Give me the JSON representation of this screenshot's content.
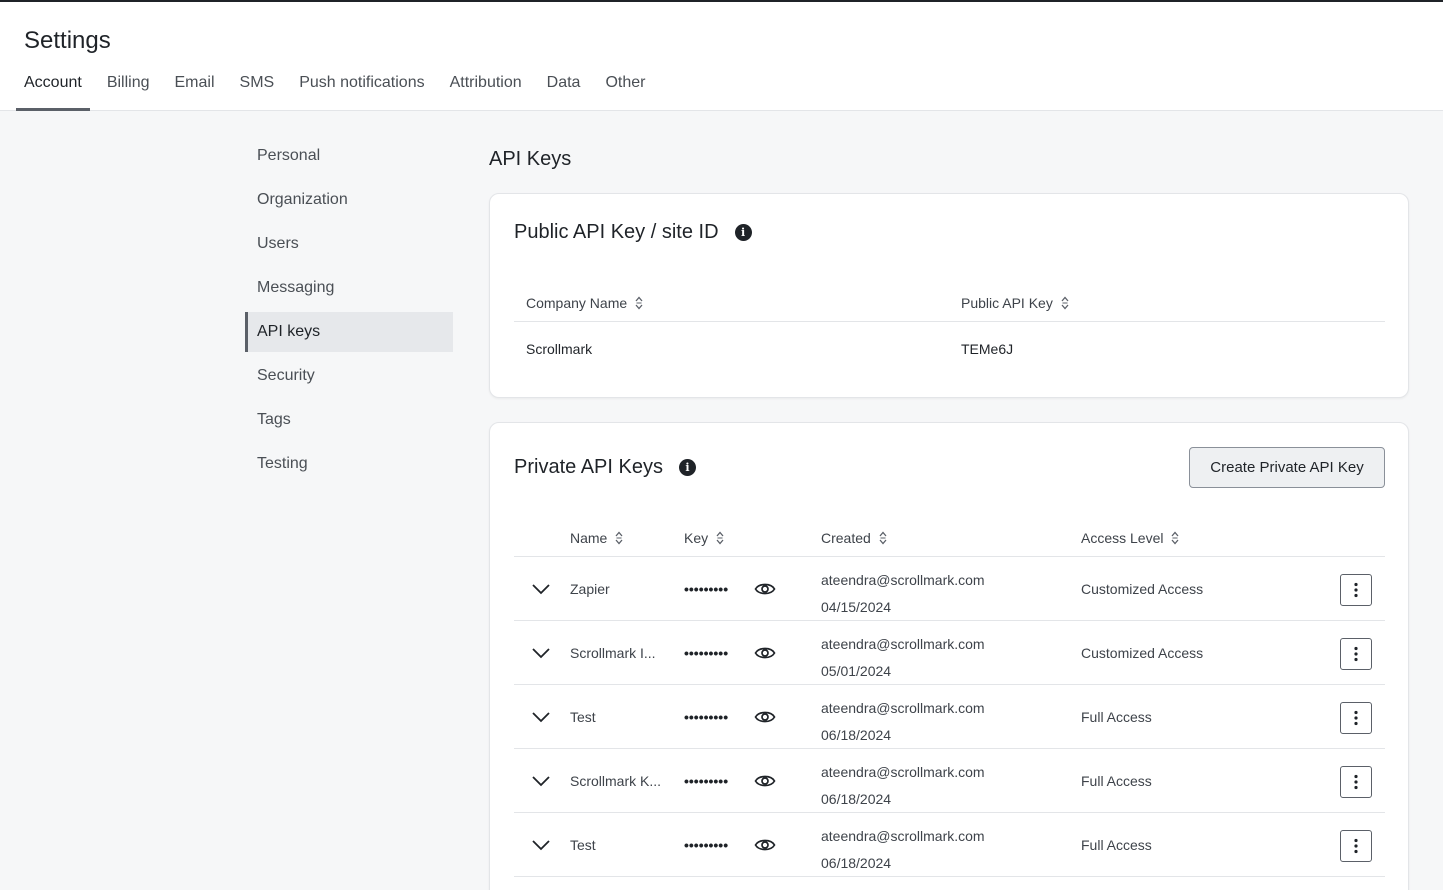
{
  "page": {
    "title": "Settings"
  },
  "tabs": [
    "Account",
    "Billing",
    "Email",
    "SMS",
    "Push notifications",
    "Attribution",
    "Data",
    "Other"
  ],
  "sidebar": {
    "items": [
      "Personal",
      "Organization",
      "Users",
      "Messaging",
      "API keys",
      "Security",
      "Tags",
      "Testing"
    ]
  },
  "main": {
    "title": "API Keys"
  },
  "public_card": {
    "title": "Public API Key / site ID",
    "columns": [
      "Company Name",
      "Public API Key"
    ],
    "row": {
      "company": "Scrollmark",
      "key": "TEMe6J"
    }
  },
  "private_card": {
    "title": "Private API Keys",
    "create_label": "Create Private API Key",
    "columns": [
      "Name",
      "Key",
      "Created",
      "Access Level"
    ],
    "masked_key": "•••••••••",
    "rows": [
      {
        "name": "Zapier",
        "email": "ateendra@scrollmark.com",
        "date": "04/15/2024",
        "access": "Customized Access"
      },
      {
        "name": "Scrollmark I...",
        "email": "ateendra@scrollmark.com",
        "date": "05/01/2024",
        "access": "Customized Access"
      },
      {
        "name": "Test",
        "email": "ateendra@scrollmark.com",
        "date": "06/18/2024",
        "access": "Full Access"
      },
      {
        "name": "Scrollmark K...",
        "email": "ateendra@scrollmark.com",
        "date": "06/18/2024",
        "access": "Full Access"
      },
      {
        "name": "Test",
        "email": "ateendra@scrollmark.com",
        "date": "06/18/2024",
        "access": "Full Access"
      }
    ]
  },
  "icons": {
    "info": "info-icon",
    "sort": "sort-icon",
    "expand": "chevron-down-icon",
    "reveal": "eye-icon",
    "menu": "more-vertical-icon"
  }
}
